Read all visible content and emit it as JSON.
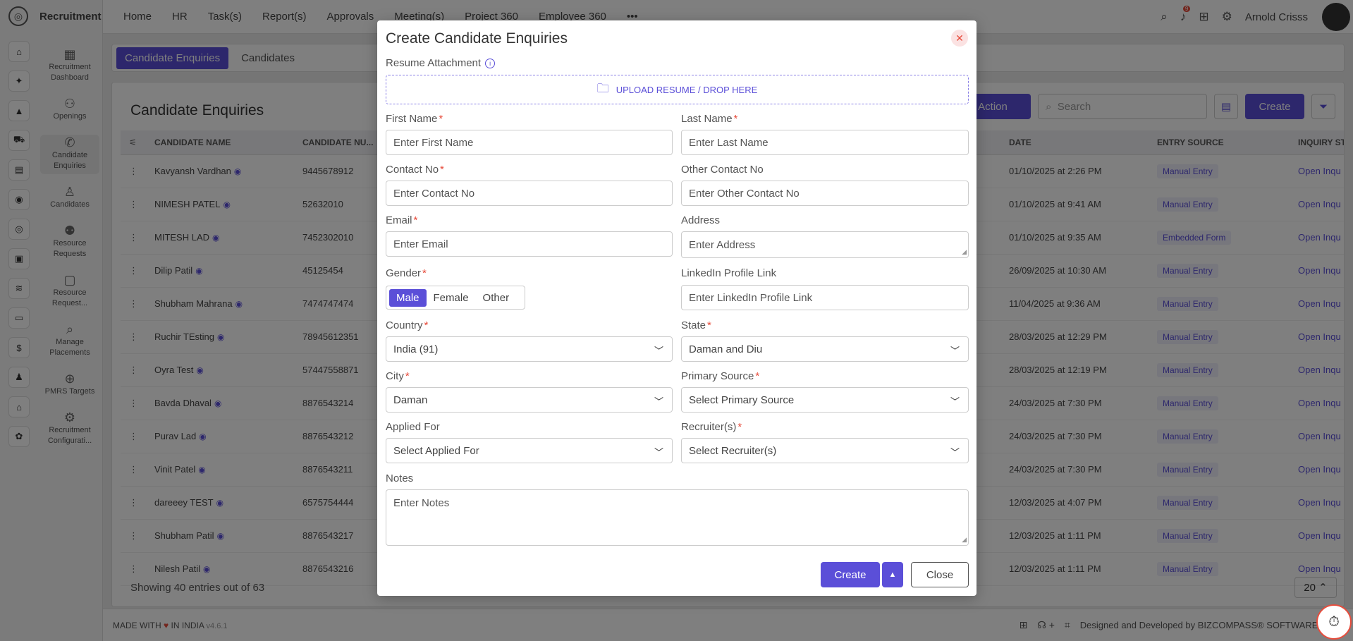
{
  "app": {
    "name": "Recruitment"
  },
  "topnav": {
    "items": [
      "Home",
      "HR",
      "Task(s)",
      "Report(s)",
      "Approvals",
      "Meeting(s)",
      "Project 360",
      "Employee 360"
    ],
    "more": "•••",
    "notifications": "9",
    "user": "Arnold Crisss"
  },
  "sidebar": {
    "items": [
      {
        "label": "Recruitment Dashboard",
        "icon": "dashboard-icon"
      },
      {
        "label": "Openings",
        "icon": "openings-icon"
      },
      {
        "label": "Candidate Enquiries",
        "icon": "phone-icon"
      },
      {
        "label": "Candidates",
        "icon": "candidates-icon"
      },
      {
        "label": "Resource Requests",
        "icon": "resource-icon"
      },
      {
        "label": "Resource Request...",
        "icon": "resource-request-icon"
      },
      {
        "label": "Manage Placements",
        "icon": "placements-icon"
      },
      {
        "label": "PMRS Targets",
        "icon": "target-icon"
      },
      {
        "label": "Recruitment Configurati...",
        "icon": "gear-icon"
      }
    ]
  },
  "tabs": {
    "active": "Candidate Enquiries",
    "other": "Candidates"
  },
  "page": {
    "title": "Candidate Enquiries",
    "action_label": "Action",
    "search_placeholder": "Search",
    "create_label": "Create",
    "showing": "Showing 40 entries out of 63",
    "page_size": "20"
  },
  "table": {
    "headers": [
      "CANDIDATE NAME",
      "CANDIDATE NU...",
      "DATE",
      "ENTRY SOURCE",
      "INQUIRY ST"
    ],
    "rows": [
      {
        "name": "Kavyansh Vardhan",
        "number": "9445678912",
        "date": "01/10/2025 at 2:26 PM",
        "source": "Manual Entry",
        "status": "Open Inqu"
      },
      {
        "name": "NIMESH PATEL",
        "number": "52632010",
        "date": "01/10/2025 at 9:41 AM",
        "source": "Manual Entry",
        "status": "Open Inqu"
      },
      {
        "name": "MITESH LAD",
        "number": "7452302010",
        "date": "01/10/2025 at 9:35 AM",
        "source": "Embedded Form",
        "status": "Open Inqu"
      },
      {
        "name": "Dilip Patil",
        "number": "45125454",
        "date": "26/09/2025 at 10:30 AM",
        "source": "Manual Entry",
        "status": "Open Inqu"
      },
      {
        "name": "Shubham Mahrana",
        "number": "7474747474",
        "date": "11/04/2025 at 9:36 AM",
        "source": "Manual Entry",
        "status": "Open Inqu"
      },
      {
        "name": "Ruchir TEsting",
        "number": "78945612351",
        "date": "28/03/2025 at 12:29 PM",
        "source": "Manual Entry",
        "status": "Open Inqu"
      },
      {
        "name": "Oyra Test",
        "number": "57447558871",
        "date": "28/03/2025 at 12:19 PM",
        "source": "Manual Entry",
        "status": "Open Inqu"
      },
      {
        "name": "Bavda Dhaval",
        "number": "8876543214",
        "date": "24/03/2025 at 7:30 PM",
        "source": "Manual Entry",
        "status": "Open Inqu"
      },
      {
        "name": "Purav Lad",
        "number": "8876543212",
        "date": "24/03/2025 at 7:30 PM",
        "source": "Manual Entry",
        "status": "Open Inqu"
      },
      {
        "name": "Vinit Patel",
        "number": "8876543211",
        "date": "24/03/2025 at 7:30 PM",
        "source": "Manual Entry",
        "status": "Open Inqu"
      },
      {
        "name": "dareeey TEST",
        "number": "6575754444",
        "date": "12/03/2025 at 4:07 PM",
        "source": "Manual Entry",
        "status": "Open Inqu"
      },
      {
        "name": "Shubham Patil",
        "number": "8876543217",
        "date": "12/03/2025 at 1:11 PM",
        "source": "Manual Entry",
        "status": "Open Inqu"
      },
      {
        "name": "Nilesh Patil",
        "number": "8876543216",
        "date": "12/03/2025 at 1:11 PM",
        "source": "Manual Entry",
        "status": "Open Inqu"
      }
    ]
  },
  "footer": {
    "made_prefix": "MADE WITH",
    "made_suffix": "IN INDIA",
    "version": "v4.6.1",
    "designed": "Designed and Developed by BIZCOMPASS® SOFTWARES PV"
  },
  "modal": {
    "title": "Create Candidate Enquiries",
    "resume_label": "Resume Attachment",
    "upload_text": "UPLOAD RESUME / DROP HERE",
    "first_name": {
      "label": "First Name",
      "placeholder": "Enter First Name"
    },
    "last_name": {
      "label": "Last Name",
      "placeholder": "Enter Last Name"
    },
    "contact": {
      "label": "Contact No",
      "placeholder": "Enter Contact No"
    },
    "other_contact": {
      "label": "Other Contact No",
      "placeholder": "Enter Other Contact No"
    },
    "email": {
      "label": "Email",
      "placeholder": "Enter Email"
    },
    "address": {
      "label": "Address",
      "placeholder": "Enter Address"
    },
    "gender": {
      "label": "Gender",
      "options": [
        "Male",
        "Female",
        "Other"
      ],
      "selected": "Male"
    },
    "linkedin": {
      "label": "LinkedIn Profile Link",
      "placeholder": "Enter LinkedIn Profile Link"
    },
    "country": {
      "label": "Country",
      "value": "India (91)"
    },
    "state": {
      "label": "State",
      "value": "Daman and Diu"
    },
    "city": {
      "label": "City",
      "value": "Daman"
    },
    "primary_source": {
      "label": "Primary Source",
      "value": "Select Primary Source"
    },
    "applied_for": {
      "label": "Applied For",
      "value": "Select Applied For"
    },
    "recruiters": {
      "label": "Recruiter(s)",
      "value": "Select Recruiter(s)"
    },
    "notes": {
      "label": "Notes",
      "placeholder": "Enter Notes"
    },
    "create_label": "Create",
    "close_label": "Close"
  },
  "colors": {
    "accent": "#5b4fd8",
    "required": "#e74c3c",
    "overlay": "rgba(0,0,0,0.5)"
  }
}
